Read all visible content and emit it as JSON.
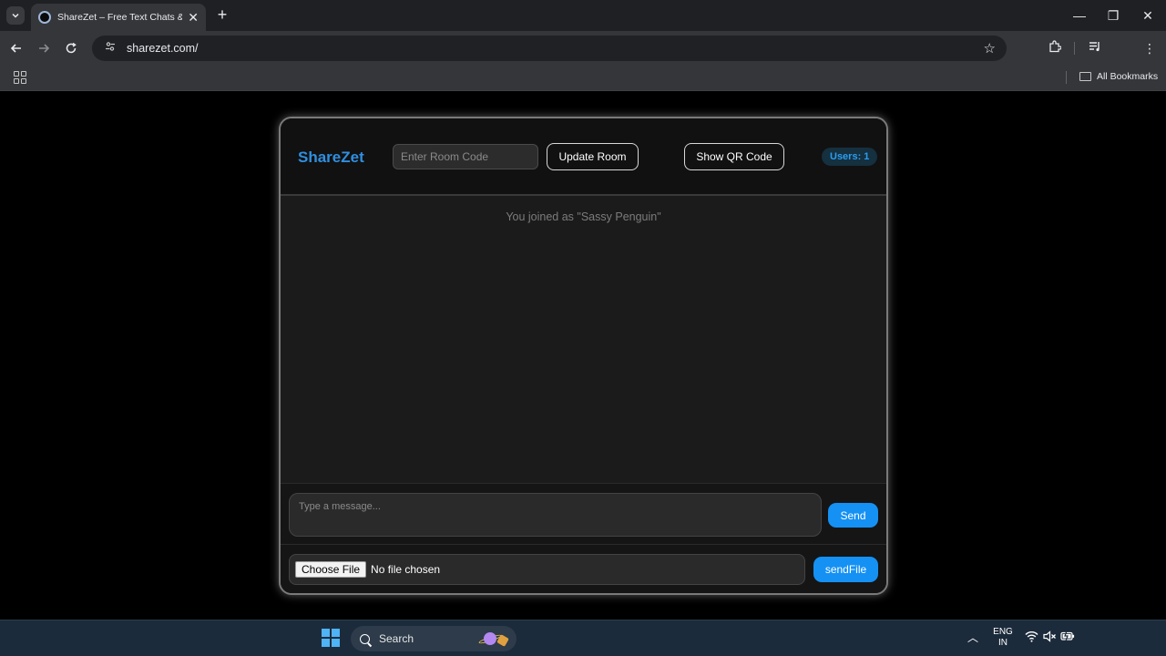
{
  "browser": {
    "tab_title": "ShareZet – Free Text Chats & File Sharing",
    "url": "sharezet.com/",
    "bookmarks_label": "All Bookmarks"
  },
  "app": {
    "brand": "ShareZet",
    "room_code_placeholder": "Enter Room Code",
    "update_room_label": "Update Room",
    "show_qr_label": "Show QR Code",
    "users_badge": "Users: 1",
    "system_message": "You joined as \"Sassy Penguin\"",
    "message_placeholder": "Type a message...",
    "send_label": "Send",
    "choose_file_label": "Choose File",
    "file_status": "No file chosen",
    "send_file_label": "sendFile",
    "colors": {
      "accent": "#1591f4",
      "brand": "#2f8fe0",
      "background": "#000000",
      "panel": "#1b1b1b"
    }
  },
  "taskbar": {
    "search_label": "Search",
    "lang_line1": "ENG",
    "lang_line2": "IN"
  }
}
